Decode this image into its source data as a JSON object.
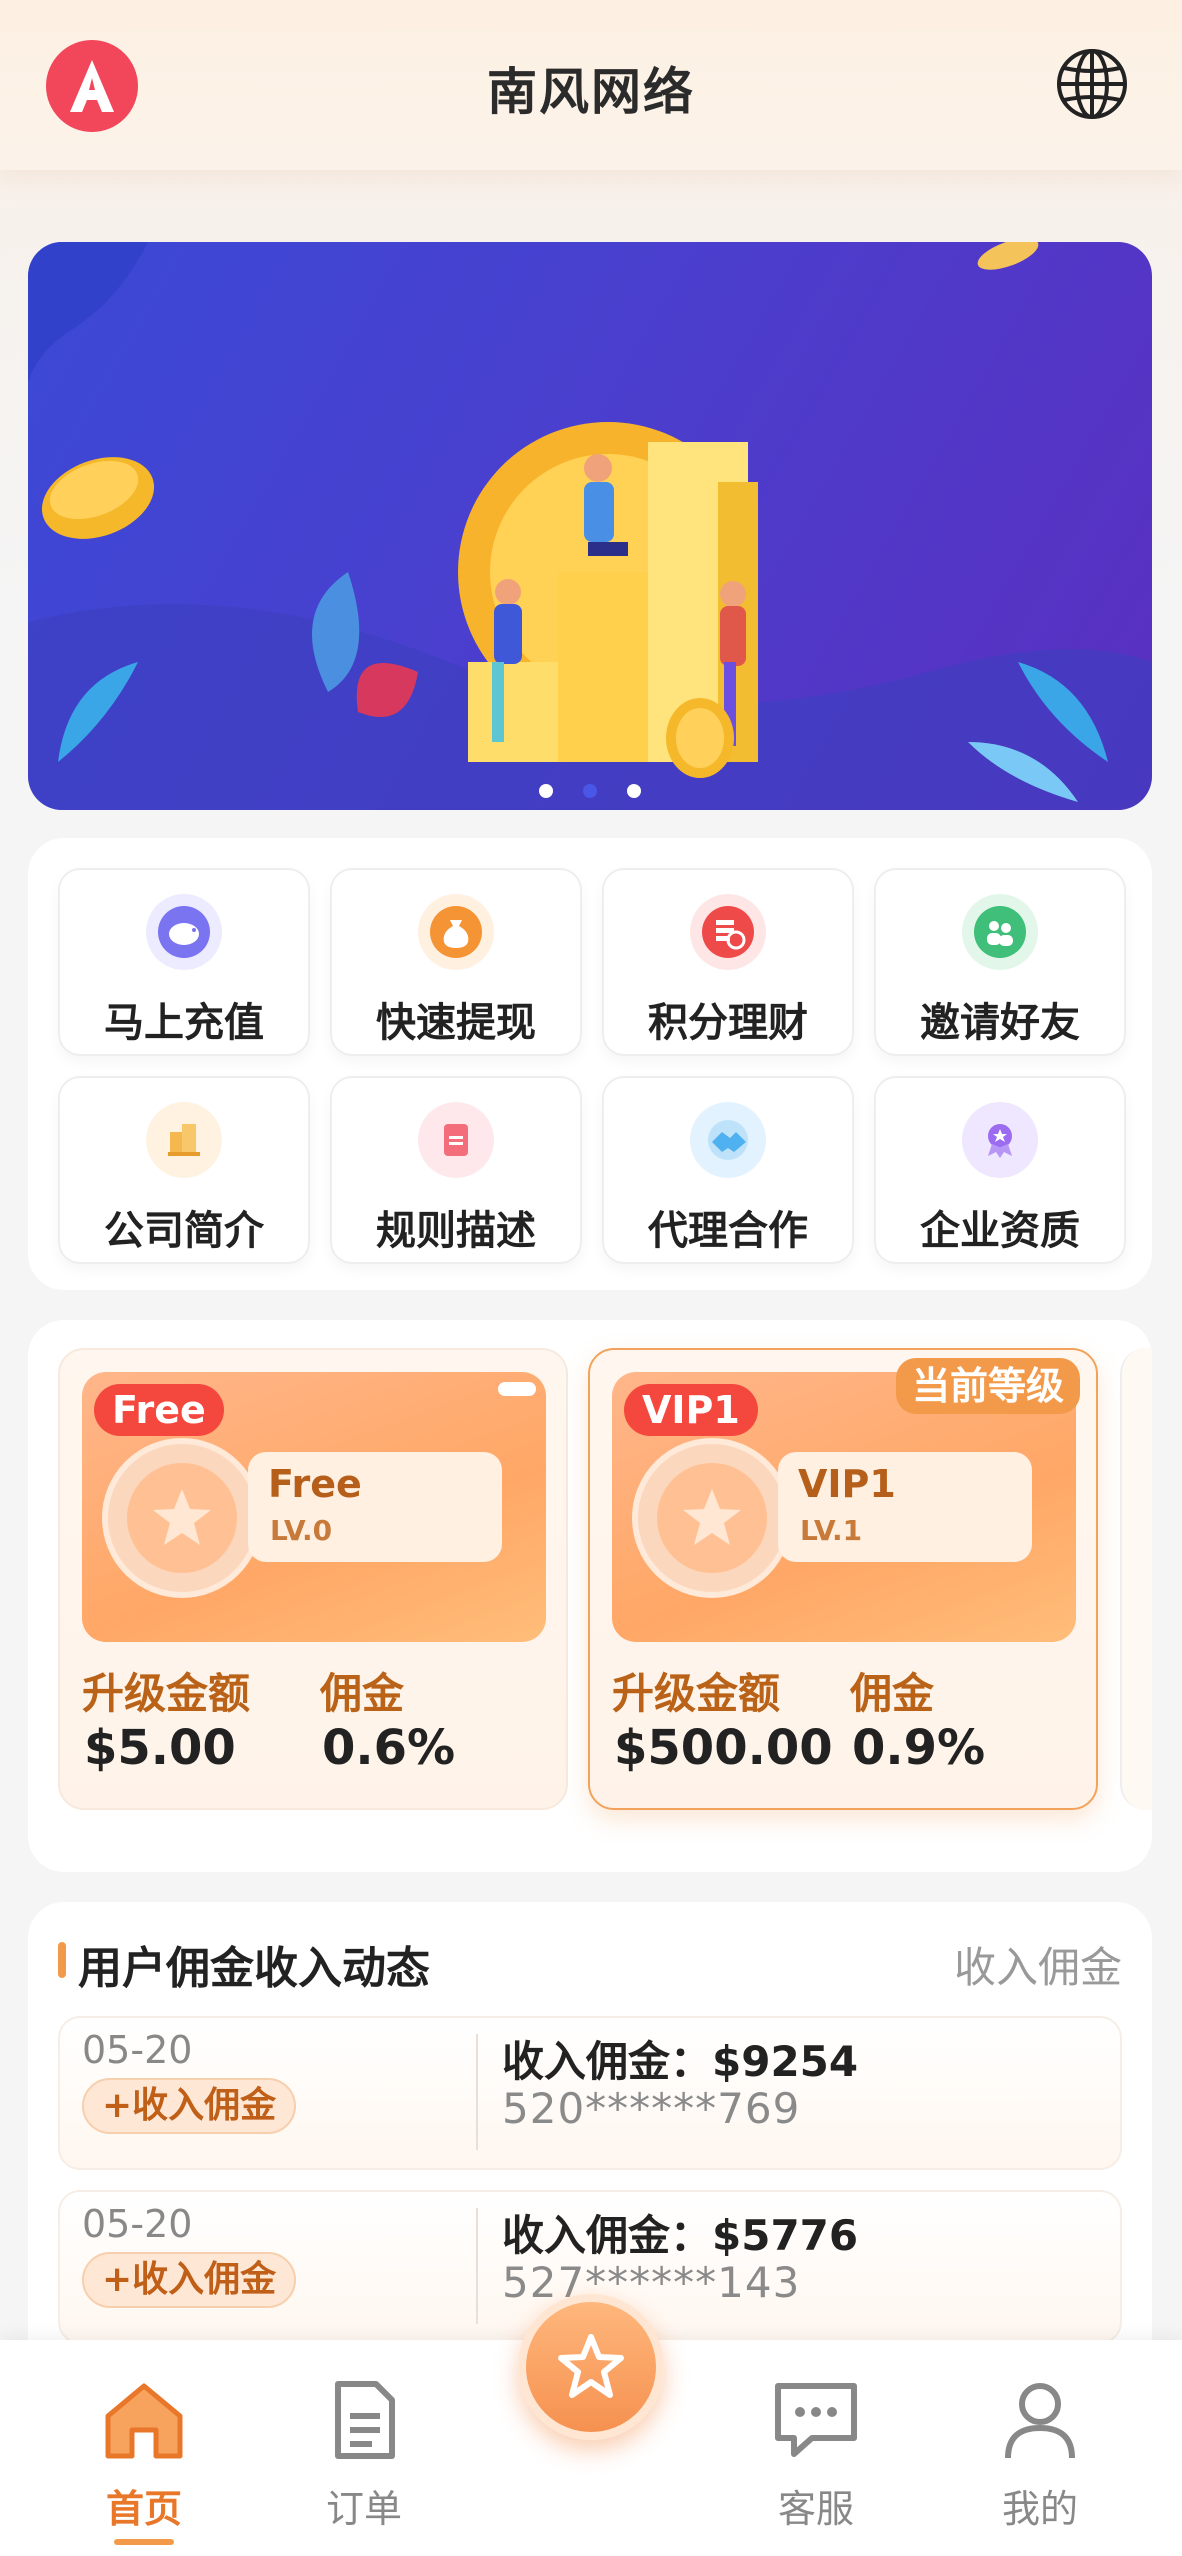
{
  "header": {
    "title": "南风网络",
    "logo_icon": "app-logo-a-icon",
    "language_icon": "globe-icon"
  },
  "banner": {
    "slides": 3,
    "active_slide": 2
  },
  "menu": {
    "items": [
      {
        "label": "马上充值",
        "icon": "piggy-bank-icon",
        "color": "#7b74f0"
      },
      {
        "label": "快速提现",
        "icon": "money-bag-icon",
        "color": "#f49435"
      },
      {
        "label": "积分理财",
        "icon": "coins-icon",
        "color": "#ee4a4a"
      },
      {
        "label": "邀请好友",
        "icon": "friends-icon",
        "color": "#3fbf79"
      },
      {
        "label": "公司简介",
        "icon": "building-icon",
        "color": "#f5b84e"
      },
      {
        "label": "规则描述",
        "icon": "rulebook-icon",
        "color": "#f46d7a"
      },
      {
        "label": "代理合作",
        "icon": "handshake-icon",
        "color": "#4fb1f0"
      },
      {
        "label": "企业资质",
        "icon": "award-icon",
        "color": "#9b6cf0"
      }
    ]
  },
  "levels": {
    "upgrade_label": "升级金额",
    "commission_label": "佣金",
    "current_tag": "当前等级",
    "items": [
      {
        "badge": "Free",
        "name": "Free",
        "lv": "LV.0",
        "amount": "$5.00",
        "commission": "0.6%",
        "current": false
      },
      {
        "badge": "VIP1",
        "name": "VIP1",
        "lv": "LV.1",
        "amount": "$500.00",
        "commission": "0.9%",
        "current": true
      }
    ]
  },
  "income": {
    "title": "用户佣金收入动态",
    "more_label": "收入佣金",
    "rows": [
      {
        "date": "05-20",
        "tag": "+收入佣金",
        "amount": "收入佣金：$9254",
        "user": "520******769"
      },
      {
        "date": "05-20",
        "tag": "+收入佣金",
        "amount": "收入佣金：$5776",
        "user": "527******143"
      }
    ]
  },
  "nav": {
    "items": [
      {
        "label": "首页",
        "icon": "home-icon",
        "active": true
      },
      {
        "label": "订单",
        "icon": "order-document-icon",
        "active": false
      },
      {
        "label": "客服",
        "icon": "chat-bubble-icon",
        "active": false
      },
      {
        "label": "我的",
        "icon": "profile-icon",
        "active": false
      }
    ],
    "center_icon": "star-icon"
  },
  "colors": {
    "accent": "#f39a4a",
    "brand_red": "#f2465a"
  }
}
